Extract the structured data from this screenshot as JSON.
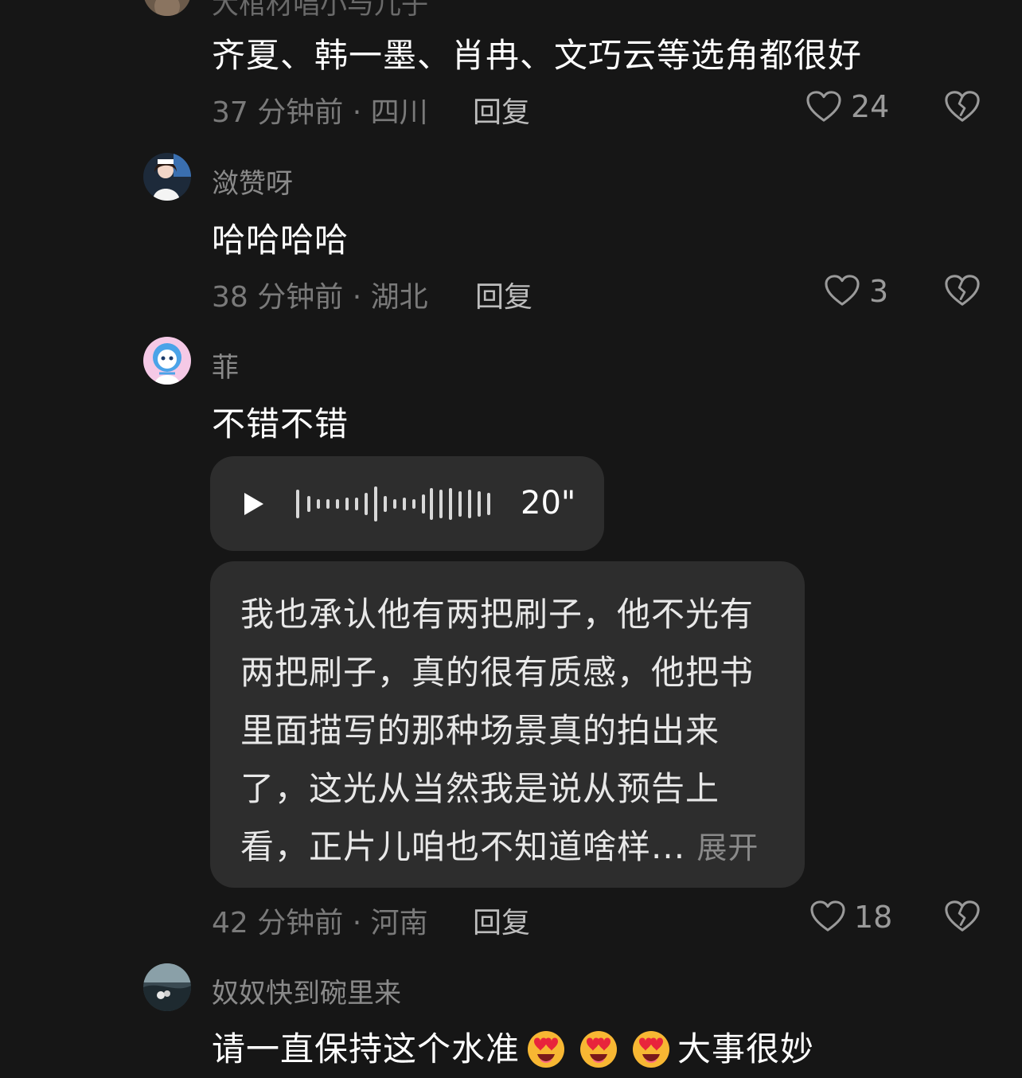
{
  "comments": [
    {
      "username": "大棺材唱小与儿子",
      "content": "齐夏、韩一墨、肖冉、文巧云等选角都很好",
      "meta": "37 分钟前 · 四川",
      "reply_label": "回复",
      "likes": "24"
    },
    {
      "username": "潋赞呀",
      "content": "哈哈哈哈",
      "meta": "38 分钟前 · 湖北",
      "reply_label": "回复",
      "likes": "3"
    },
    {
      "username": "菲",
      "content": "不错不错",
      "voice": {
        "duration": "20\""
      },
      "transcript": {
        "lines": [
          "我也承认他有两把刷子，他不光有",
          "两把刷子，真的很有质感，他把书",
          "里面描写的那种场景真的拍出来",
          "了，这光从当然我是说从预告上",
          "看，正片儿咱也不知道啥样..."
        ],
        "expand_label": "展开"
      },
      "meta": "42 分钟前 · 河南",
      "reply_label": "回复",
      "likes": "18"
    },
    {
      "username": "奴奴快到碗里来",
      "content_before": "请一直保持这个水准",
      "emoji": "heart-eyes-emoji",
      "content_after": "大事很妙"
    }
  ]
}
